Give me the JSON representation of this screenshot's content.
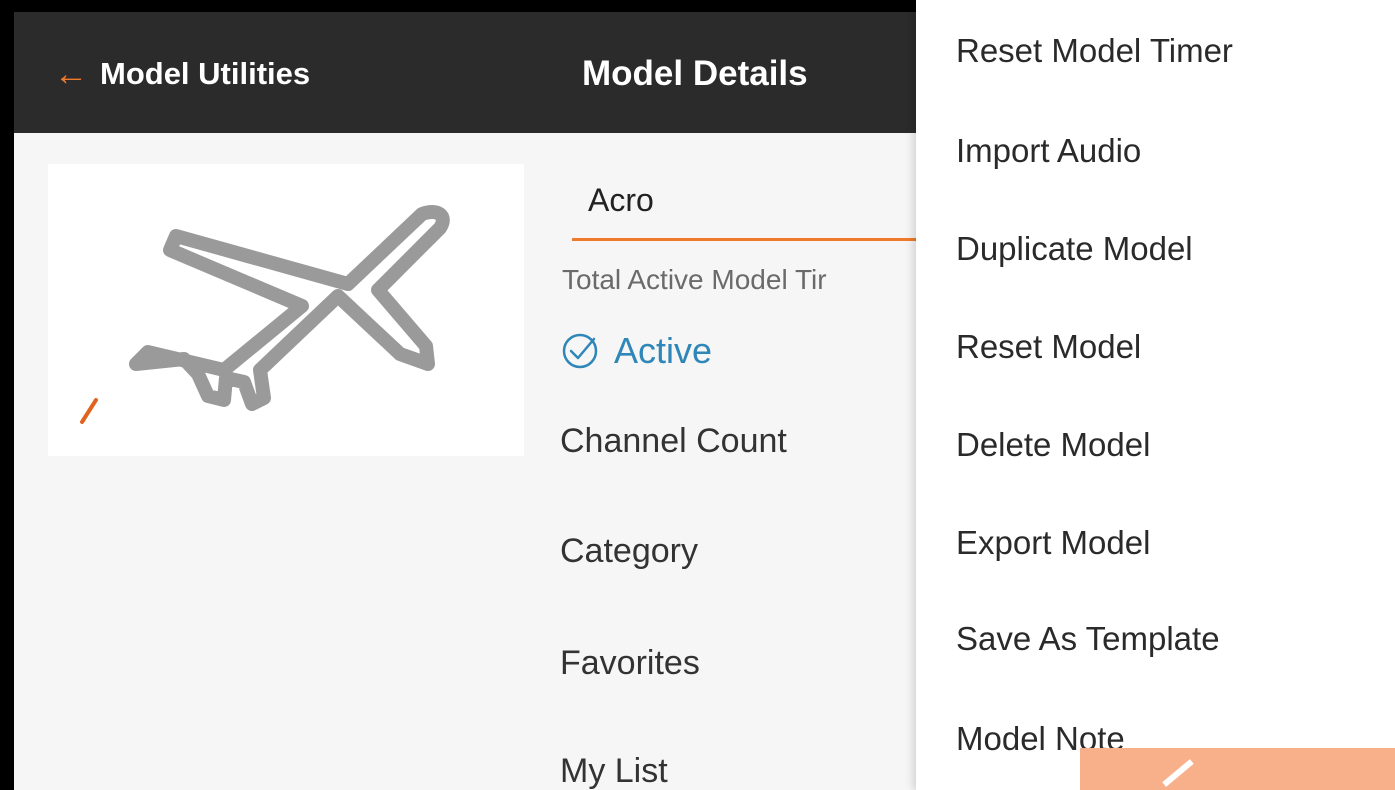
{
  "header": {
    "back_label": "Model Utilities",
    "back_icon": "arrow-left-icon",
    "title": "Model Details"
  },
  "model": {
    "image_icon": "airplane-icon",
    "name": "Acro",
    "timer_label": "Total Active Model Tir",
    "active_label": "Active",
    "active_icon": "check-circle-icon"
  },
  "fields": [
    {
      "label": "Channel Count"
    },
    {
      "label": "Category"
    },
    {
      "label": "Favorites"
    },
    {
      "label": "My List"
    }
  ],
  "menu": {
    "items": [
      {
        "label": "Reset Model Timer"
      },
      {
        "label": "Import Audio"
      },
      {
        "label": "Duplicate Model"
      },
      {
        "label": "Reset Model"
      },
      {
        "label": "Delete Model"
      },
      {
        "label": "Export Model"
      },
      {
        "label": "Save As Template"
      },
      {
        "label": "Model Note"
      }
    ]
  },
  "colors": {
    "accent": "#f07a2c",
    "header_bg": "#2b2b2b",
    "active": "#2f86b8",
    "badge": "#f7b08a"
  }
}
